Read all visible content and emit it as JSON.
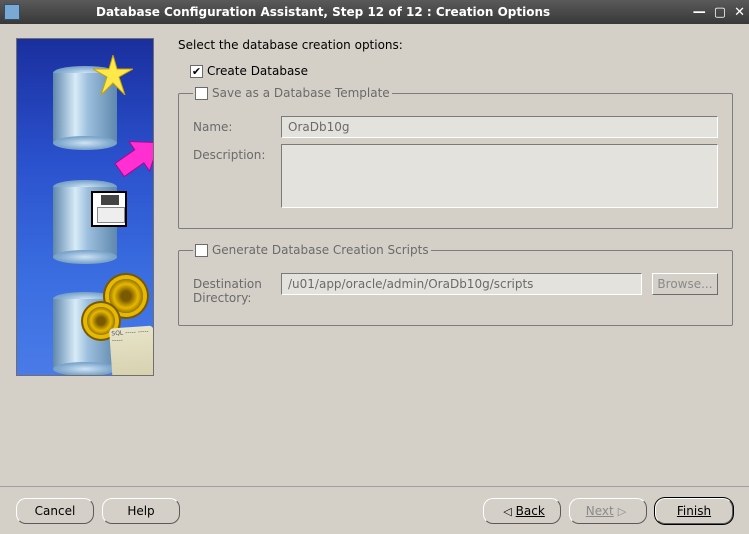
{
  "window": {
    "title": "Database Configuration Assistant, Step 12 of 12 : Creation Options"
  },
  "prompt": "Select the database creation options:",
  "options": {
    "create_database": {
      "label": "Create Database",
      "checked": true
    },
    "save_template": {
      "legend": "Save as a Database Template",
      "checked": false,
      "name_label": "Name:",
      "name_value": "OraDb10g",
      "desc_label": "Description:",
      "desc_value": ""
    },
    "gen_scripts": {
      "legend": "Generate Database Creation Scripts",
      "checked": false,
      "dest_label": "Destination Directory:",
      "dest_value": "/u01/app/oracle/admin/OraDb10g/scripts",
      "browse_label": "Browse..."
    }
  },
  "scroll_text": "SQL\n-----\n-----\n-----",
  "buttons": {
    "cancel": "Cancel",
    "help": "Help",
    "back_arrow": "◁",
    "back": "Back",
    "next": "Next",
    "next_arrow": "▷",
    "finish": "Finish"
  }
}
